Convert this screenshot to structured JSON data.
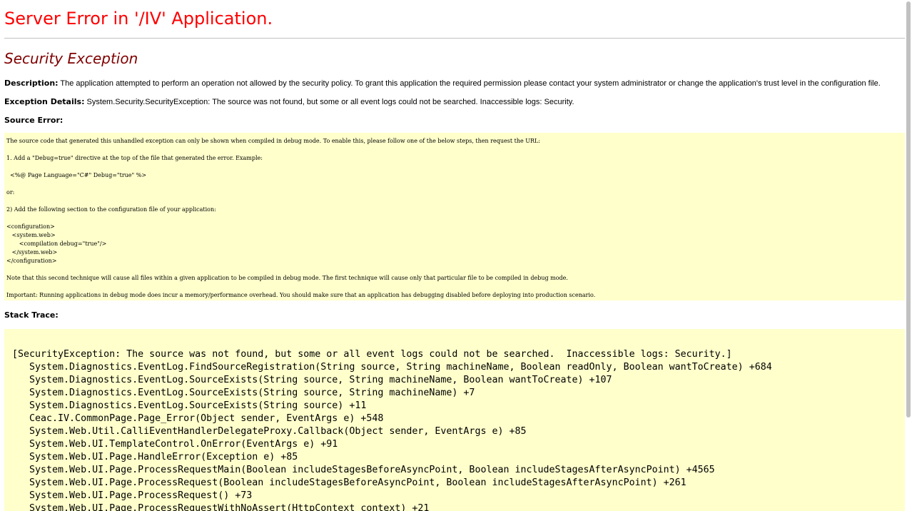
{
  "header": {
    "title": "Server Error in '/IV' Application.",
    "exception_type": "Security Exception"
  },
  "description": {
    "label": "Description:",
    "text": "The application attempted to perform an operation not allowed by the security policy.  To grant this application the required permission please contact your system administrator or change the application's trust level in the configuration file."
  },
  "exception_details": {
    "label": "Exception Details:",
    "text": "System.Security.SecurityException: The source was not found, but some or all event logs could not be searched.  Inaccessible logs: Security."
  },
  "source_error": {
    "label": "Source Error:",
    "lines": [
      "The source code that generated this unhandled exception can only be shown when compiled in debug mode. To enable this, please follow one of the below steps, then request the URL:",
      "1. Add a \"Debug=true\" directive at the top of the file that generated the error. Example:",
      "  <%@ Page Language=\"C#\" Debug=\"true\" %>",
      "or:",
      "2) Add the following section to the configuration file of your application:",
      "<configuration>",
      "   <system.web>",
      "       <compilation debug=\"true\"/>",
      "   </system.web>",
      "</configuration>",
      "Note that this second technique will cause all files within a given application to be compiled in debug mode. The first technique will cause only that particular file to be compiled in debug mode.",
      "Important: Running applications in debug mode does incur a memory/performance overhead. You should make sure that an application has debugging disabled before deploying into production scenario."
    ]
  },
  "stack_trace": {
    "label": "Stack Trace:",
    "lines": [
      "[SecurityException: The source was not found, but some or all event logs could not be searched.  Inaccessible logs: Security.]",
      "   System.Diagnostics.EventLog.FindSourceRegistration(String source, String machineName, Boolean readOnly, Boolean wantToCreate) +684",
      "   System.Diagnostics.EventLog.SourceExists(String source, String machineName, Boolean wantToCreate) +107",
      "   System.Diagnostics.EventLog.SourceExists(String source, String machineName) +7",
      "   System.Diagnostics.EventLog.SourceExists(String source) +11",
      "   Ceac.IV.CommonPage.Page_Error(Object sender, EventArgs e) +548",
      "   System.Web.Util.CalliEventHandlerDelegateProxy.Callback(Object sender, EventArgs e) +85",
      "   System.Web.UI.TemplateControl.OnError(EventArgs e) +91",
      "   System.Web.UI.Page.HandleError(Exception e) +85",
      "   System.Web.UI.Page.ProcessRequestMain(Boolean includeStagesBeforeAsyncPoint, Boolean includeStagesAfterAsyncPoint) +4565",
      "   System.Web.UI.Page.ProcessRequest(Boolean includeStagesBeforeAsyncPoint, Boolean includeStagesAfterAsyncPoint) +261",
      "   System.Web.UI.Page.ProcessRequest() +73",
      "   System.Web.UI.Page.ProcessRequestWithNoAssert(HttpContext context) +21"
    ]
  },
  "colors": {
    "title": "#ff0000",
    "subtitle": "#800000",
    "code_background": "#ffffcc"
  }
}
